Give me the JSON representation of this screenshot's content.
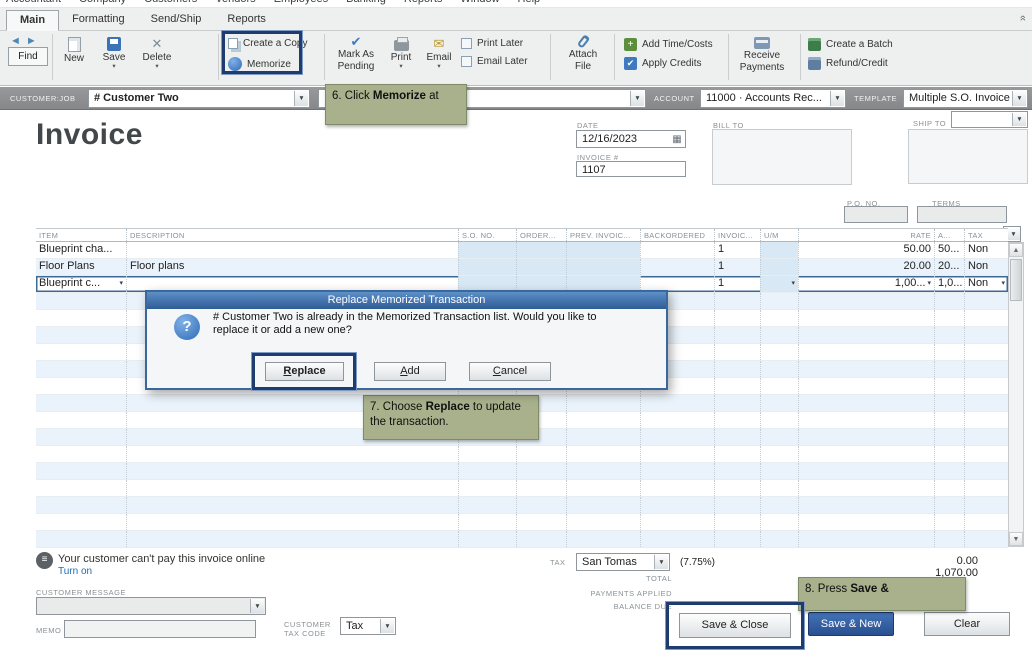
{
  "menubar": {
    "items": [
      "Accountant",
      "Company",
      "Customers",
      "Vendors",
      "Employees",
      "Banking",
      "Reports",
      "Window",
      "Help"
    ]
  },
  "ribbon": {
    "tabs": [
      "Main",
      "Formatting",
      "Send/Ship",
      "Reports"
    ],
    "active_tab": "Main"
  },
  "toolbar": {
    "find": "Find",
    "new": "New",
    "save": "Save",
    "delete": "Delete",
    "create_copy": "Create a Copy",
    "memorize": "Memorize",
    "mark_as_pending_1": "Mark As",
    "mark_as_pending_2": "Pending",
    "print": "Print",
    "email": "Email",
    "print_later": "Print Later",
    "email_later": "Email Later",
    "attach_1": "Attach",
    "attach_2": "File",
    "add_time_costs": "Add Time/Costs",
    "apply_credits": "Apply Credits",
    "receive_1": "Receive",
    "receive_2": "Payments",
    "create_batch": "Create a Batch",
    "refund_credit": "Refund/Credit"
  },
  "customer_bar": {
    "customer_label": "CUSTOMER:JOB",
    "customer_value": "# Customer Two",
    "account_label": "ACCOUNT",
    "account_value": "11000 · Accounts Rec...",
    "template_label": "TEMPLATE",
    "template_value": "Multiple S.O. Invoice"
  },
  "invoice": {
    "title": "Invoice",
    "date_label": "DATE",
    "date_value": "12/16/2023",
    "invoice_no_label": "INVOICE #",
    "invoice_no_value": "1107",
    "bill_to_label": "BILL TO",
    "ship_to_label": "SHIP TO",
    "po_label": "P.O. NO.",
    "terms_label": "TERMS"
  },
  "table": {
    "headers": [
      "ITEM",
      "DESCRIPTION",
      "S.O. NO.",
      "ORDER...",
      "PREV. INVOIC...",
      "BACKORDERED",
      "INVOIC...",
      "U/M",
      "RATE",
      "A...",
      "TAX"
    ],
    "rows": [
      [
        "Blueprint cha...",
        "",
        "",
        "",
        "",
        "",
        "1",
        "",
        "50.00",
        "50...",
        "Non"
      ],
      [
        "Floor Plans",
        "Floor plans",
        "",
        "",
        "",
        "",
        "1",
        "",
        "20.00",
        "20...",
        "Non"
      ],
      [
        "Blueprint c...",
        "",
        "",
        "",
        "",
        "",
        "1",
        "",
        "1,00...",
        "1,0...",
        "Non"
      ]
    ]
  },
  "modal": {
    "title": "Replace Memorized Transaction",
    "message_line1": "# Customer Two is already in the Memorized Transaction list.  Would you like to",
    "message_line2": "replace it or add a new one?",
    "replace": "Replace",
    "add": "Add",
    "cancel": "Cancel"
  },
  "callouts": {
    "c6": {
      "prefix": "6. Click ",
      "bold": "Memorize",
      "suffix": " at"
    },
    "c7": {
      "prefix": "7. Choose ",
      "bold": "Replace",
      "suffix": " to update the transaction."
    },
    "c8": {
      "prefix": "8. Press ",
      "bold": "Save &",
      "suffix": ""
    }
  },
  "footer": {
    "online_note": "Your customer can't pay this invoice online",
    "turn_on": "Turn on",
    "customer_message_label": "CUSTOMER MESSAGE",
    "memo_label": "MEMO",
    "customer_tax_code_line1": "CUSTOMER",
    "customer_tax_code_line2": "TAX CODE",
    "tax_code_value": "Tax",
    "tax_label": "TAX",
    "tax_value": "San Tomas",
    "tax_rate": "(7.75%)",
    "tax_amount": "0.00",
    "total_label": "TOTAL",
    "total_value": "1,070.00",
    "payments_applied_label": "PAYMENTS APPLIED",
    "balance_due_label": "BALANCE DUE",
    "save_close": "Save & Close",
    "save_new": "Save & New",
    "clear": "Clear"
  },
  "icons": {
    "back_arrow": "◄",
    "forward_arrow": "►",
    "dropdown_arrow": "▼",
    "small_caret": "▾",
    "calendar_glyph": "▦",
    "question_glyph": "?",
    "bubble_lines_glyph": "≡",
    "scroll_up_glyph": "▲",
    "scroll_down_glyph": "▼",
    "collapse_glyph": "»",
    "x_glyph": "✕",
    "check_glyph": "✔",
    "mail_glyph": "✉",
    "plus_glyph": "+"
  },
  "colors": {
    "highlight_border": "#1e3c6d",
    "callout_bg": "#a8b18c",
    "modal_title_blue": "#2d5b96",
    "save_new_blue": "#29508f",
    "row_alt": "#eaf3fb"
  }
}
